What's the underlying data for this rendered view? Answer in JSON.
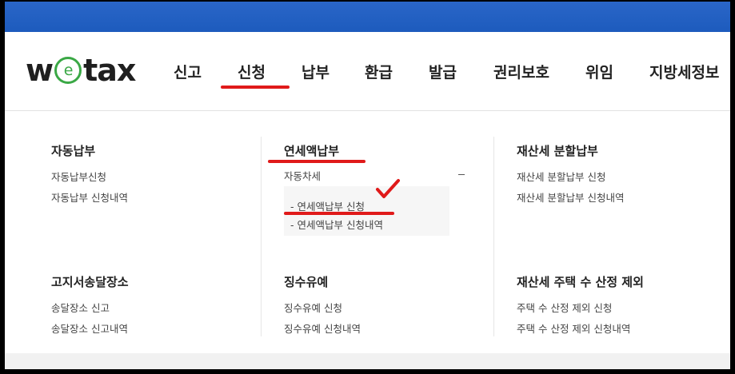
{
  "header": {
    "logo": {
      "pre": "w",
      "circle": "e",
      "post": "tax"
    },
    "menu": [
      "신고",
      "신청",
      "납부",
      "환급",
      "발급",
      "권리보호",
      "위임",
      "지방세정보"
    ],
    "active_menu": "신청"
  },
  "colors": {
    "topbar": "#1d5bbd",
    "logo_e": "#3aa845",
    "annotation_red": "#e01a1a"
  },
  "groups": {
    "auto_payment": {
      "title": "자동납부",
      "items": [
        "자동납부신청",
        "자동납부 신청내역"
      ]
    },
    "annual_tax": {
      "title": "연세액납부",
      "items": [
        "자동차세"
      ],
      "sub_items": [
        "- 연세액납부 신청",
        "- 연세액납부 신청내역"
      ]
    },
    "installment": {
      "title": "재산세 분할납부",
      "items": [
        "재산세 분할납부 신청",
        "재산세 분할납부 신청내역"
      ]
    },
    "notice_address": {
      "title": "고지서송달장소",
      "items": [
        "송달장소 신고",
        "송달장소 신고내역"
      ]
    },
    "deferral": {
      "title": "징수유예",
      "items": [
        "징수유예 신청",
        "징수유예 신청내역"
      ]
    },
    "house_exclusion": {
      "title": "재산세 주택 수 산정 제외",
      "items": [
        "주택 수 산정 제외 신청",
        "주택 수 산정 제외 신청내역"
      ]
    }
  }
}
